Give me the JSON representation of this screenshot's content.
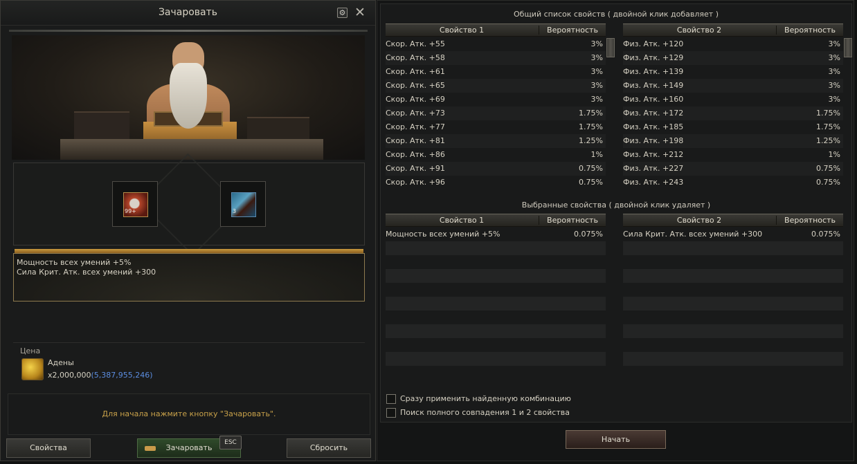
{
  "left_window": {
    "title": "Зачаровать",
    "slots": [
      {
        "icon": "rune-stone-icon",
        "qty": "99+"
      },
      {
        "icon": "dragon-scroll-icon",
        "qty": "3"
      }
    ],
    "result_lines": [
      "Мощность всех умений +5%",
      "Сила Крит. Атк. всех умений +300"
    ],
    "price": {
      "label": "Цена",
      "item_name": "Адены",
      "amount": "x2,000,000",
      "owned": "(5,387,955,246)"
    },
    "hint": "Для начала нажмите кнопку \"Зачаровать\".",
    "buttons": {
      "properties": "Свойства",
      "enchant": "Зачаровать",
      "esc": "ESC",
      "reset": "Сбросить"
    }
  },
  "right_window": {
    "all_title": "Общий список свойств ( двойной клик добавляет )",
    "selected_title": "Выбранные свойства ( двойной клик удаляет )",
    "col_prop1": "Свойство 1",
    "col_prop2": "Свойство 2",
    "col_prob": "Вероятность",
    "list1": [
      {
        "name": "Скор. Атк. +55",
        "prob": "3%"
      },
      {
        "name": "Скор. Атк. +58",
        "prob": "3%"
      },
      {
        "name": "Скор. Атк. +61",
        "prob": "3%"
      },
      {
        "name": "Скор. Атк. +65",
        "prob": "3%"
      },
      {
        "name": "Скор. Атк. +69",
        "prob": "3%"
      },
      {
        "name": "Скор. Атк. +73",
        "prob": "1.75%"
      },
      {
        "name": "Скор. Атк. +77",
        "prob": "1.75%"
      },
      {
        "name": "Скор. Атк. +81",
        "prob": "1.25%"
      },
      {
        "name": "Скор. Атк. +86",
        "prob": "1%"
      },
      {
        "name": "Скор. Атк. +91",
        "prob": "0.75%"
      },
      {
        "name": "Скор. Атк. +96",
        "prob": "0.75%"
      }
    ],
    "list2": [
      {
        "name": "Физ. Атк. +120",
        "prob": "3%"
      },
      {
        "name": "Физ. Атк. +129",
        "prob": "3%"
      },
      {
        "name": "Физ. Атк. +139",
        "prob": "3%"
      },
      {
        "name": "Физ. Атк. +149",
        "prob": "3%"
      },
      {
        "name": "Физ. Атк. +160",
        "prob": "3%"
      },
      {
        "name": "Физ. Атк. +172",
        "prob": "1.75%"
      },
      {
        "name": "Физ. Атк. +185",
        "prob": "1.75%"
      },
      {
        "name": "Физ. Атк. +198",
        "prob": "1.25%"
      },
      {
        "name": "Физ. Атк. +212",
        "prob": "1%"
      },
      {
        "name": "Физ. Атк. +227",
        "prob": "0.75%"
      },
      {
        "name": "Физ. Атк. +243",
        "prob": "0.75%"
      }
    ],
    "selected1": [
      {
        "name": "Мощность всех умений +5%",
        "prob": "0.075%"
      }
    ],
    "selected2": [
      {
        "name": "Сила Крит. Атк. всех умений +300",
        "prob": "0.075%"
      }
    ],
    "options": [
      {
        "label": "Сразу применить найденную комбинацию",
        "checked": false
      },
      {
        "label": "Поиск полного совпадения 1 и 2 свойства",
        "checked": false
      }
    ],
    "start_button": "Начать"
  }
}
